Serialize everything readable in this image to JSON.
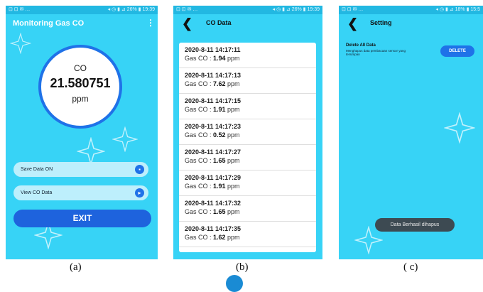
{
  "panel_a": {
    "status_left": "⊡ ⊡ ✉ …",
    "status_right": "◂ ◷ ▮ ⊿ 26% ▮ 19:39",
    "title": "Monitoring Gas CO",
    "gauge": {
      "label": "CO",
      "value": "21.580751",
      "unit": "ppm"
    },
    "save_label": "Save Data  ON",
    "view_label": "View CO Data",
    "exit_label": "EXIT"
  },
  "panel_b": {
    "status_left": "⊡ ⊡ ✉ …",
    "status_right": "◂ ◷ ▮ ⊿ 26% ▮ 19:39",
    "title": "CO Data",
    "entries": [
      {
        "timestamp": "2020-8-11 14:17:11",
        "prefix": "Gas CO : ",
        "value": "1.94",
        "unit": " ppm"
      },
      {
        "timestamp": "2020-8-11 14:17:13",
        "prefix": "Gas CO : ",
        "value": "7.62",
        "unit": " ppm"
      },
      {
        "timestamp": "2020-8-11 14:17:15",
        "prefix": "Gas CO : ",
        "value": "1.91",
        "unit": " ppm"
      },
      {
        "timestamp": "2020-8-11 14:17:23",
        "prefix": "Gas CO : ",
        "value": "0.52",
        "unit": " ppm"
      },
      {
        "timestamp": "2020-8-11 14:17:27",
        "prefix": "Gas CO : ",
        "value": "1.65",
        "unit": " ppm"
      },
      {
        "timestamp": "2020-8-11 14:17:29",
        "prefix": "Gas CO : ",
        "value": "1.91",
        "unit": " ppm"
      },
      {
        "timestamp": "2020-8-11 14:17:32",
        "prefix": "Gas CO : ",
        "value": "1.65",
        "unit": " ppm"
      },
      {
        "timestamp": "2020-8-11 14:17:35",
        "prefix": "Gas CO : ",
        "value": "1.62",
        "unit": " ppm"
      }
    ]
  },
  "panel_c": {
    "status_left": "⊡ ⊡ ✉ …",
    "status_right": "◂ ◷ ▮ ⊿ 18% ▮ 15:5",
    "title": "Setting",
    "delete_title": "Delete All Data",
    "delete_desc": "Menghapus data pembacaan sensor yang tersimpan",
    "delete_button": "DELETE",
    "toast": "Data Berhasil dihapus"
  },
  "captions": {
    "a": "(a)",
    "b": "(b)",
    "c": "( c)"
  },
  "colors": {
    "screen_bg": "#37d3f6",
    "accent_blue": "#1f72e8",
    "status_bar": "#22b8e2"
  },
  "icons": {
    "back": "back-arrow-icon",
    "more": "more-vert-icon",
    "save": "save-icon",
    "view": "view-icon",
    "decoration": "star-outline-icon"
  }
}
